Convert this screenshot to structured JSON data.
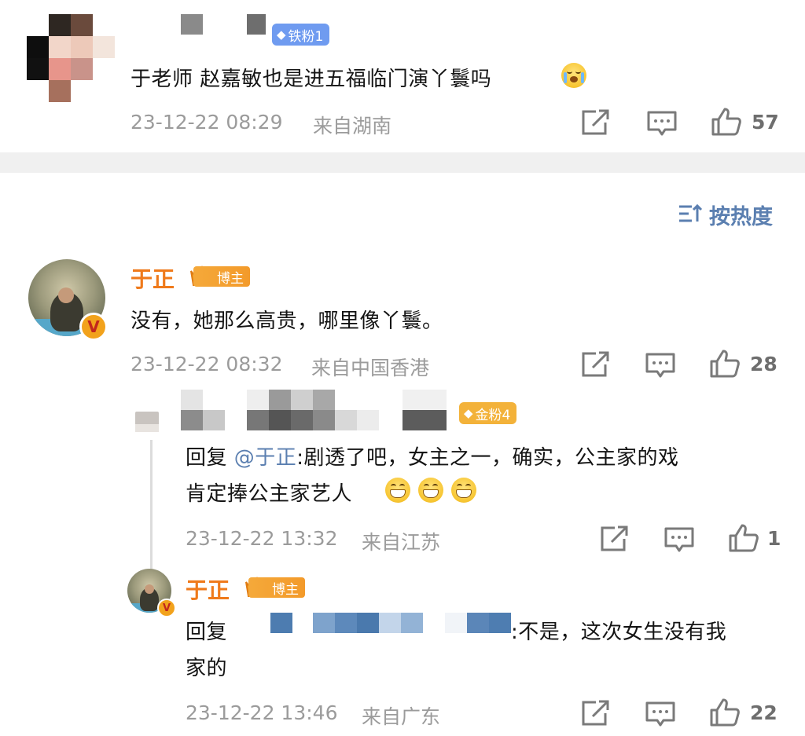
{
  "comment1": {
    "fan_badge": "铁粉1",
    "text": "于老师 赵嘉敏也是进五福临门演丫鬟吗",
    "emoji": "crying-face-emoji",
    "time": "23-12-22 08:29",
    "location": "来自湖南",
    "like_count": "57"
  },
  "sort": {
    "label": "按热度"
  },
  "comment2": {
    "author": "于正",
    "author_badge": "博主",
    "text": "没有，她那么高贵，哪里像丫鬟。",
    "time": "23-12-22 08:32",
    "location": "来自中国香港",
    "like_count": "28"
  },
  "reply1": {
    "fan_badge": "金粉4",
    "prefix": "回复 ",
    "mention": "@于正",
    "text_line1": ":剧透了吧，女主之一，确实，公主家的戏",
    "text_line2": "肯定捧公主家艺人",
    "time": "23-12-22 13:32",
    "location": "来自江苏",
    "like_count": "1"
  },
  "reply2": {
    "author": "于正",
    "author_badge": "博主",
    "prefix": "回复",
    "text_line1": ":不是，这次女生没有我",
    "text_line2": "家的",
    "time": "23-12-22 13:46",
    "location": "来自广东",
    "like_count": "22"
  },
  "colors": {
    "author_orange": "#ef7a1b",
    "badge_blue": "#6f9bf0",
    "badge_gold": "#f3b23a",
    "meta_gray": "#9b9b9b",
    "mention_blue": "#5b7fb0"
  }
}
